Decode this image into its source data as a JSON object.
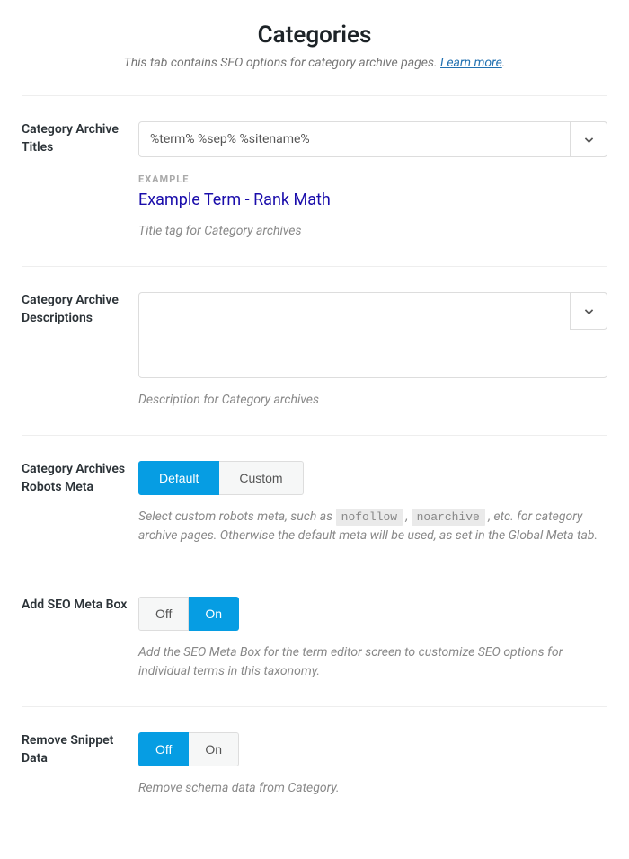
{
  "header": {
    "title": "Categories",
    "subtitle_prefix": "This tab contains SEO options for category archive pages. ",
    "learn_more": "Learn more",
    "subtitle_suffix": "."
  },
  "sections": {
    "archive_titles": {
      "label": "Category Archive Titles",
      "input_value": "%term% %sep% %sitename%",
      "example_label": "EXAMPLE",
      "example_value": "Example Term - Rank Math",
      "help": "Title tag for Category archives"
    },
    "archive_descriptions": {
      "label": "Category Archive Descriptions",
      "input_value": "",
      "help": "Description for Category archives"
    },
    "robots_meta": {
      "label": "Category Archives Robots Meta",
      "options": {
        "default": "Default",
        "custom": "Custom"
      },
      "help_pre": "Select custom robots meta, such as ",
      "code1": "nofollow",
      "help_mid": " , ",
      "code2": "noarchive",
      "help_post": " , etc. for category archive pages. Otherwise the default meta will be used, as set in the Global Meta tab."
    },
    "seo_meta_box": {
      "label": "Add SEO Meta Box",
      "options": {
        "off": "Off",
        "on": "On"
      },
      "help": "Add the SEO Meta Box for the term editor screen to customize SEO options for individual terms in this taxonomy."
    },
    "remove_snippet": {
      "label": "Remove Snippet Data",
      "options": {
        "off": "Off",
        "on": "On"
      },
      "help": "Remove schema data from Category."
    }
  }
}
